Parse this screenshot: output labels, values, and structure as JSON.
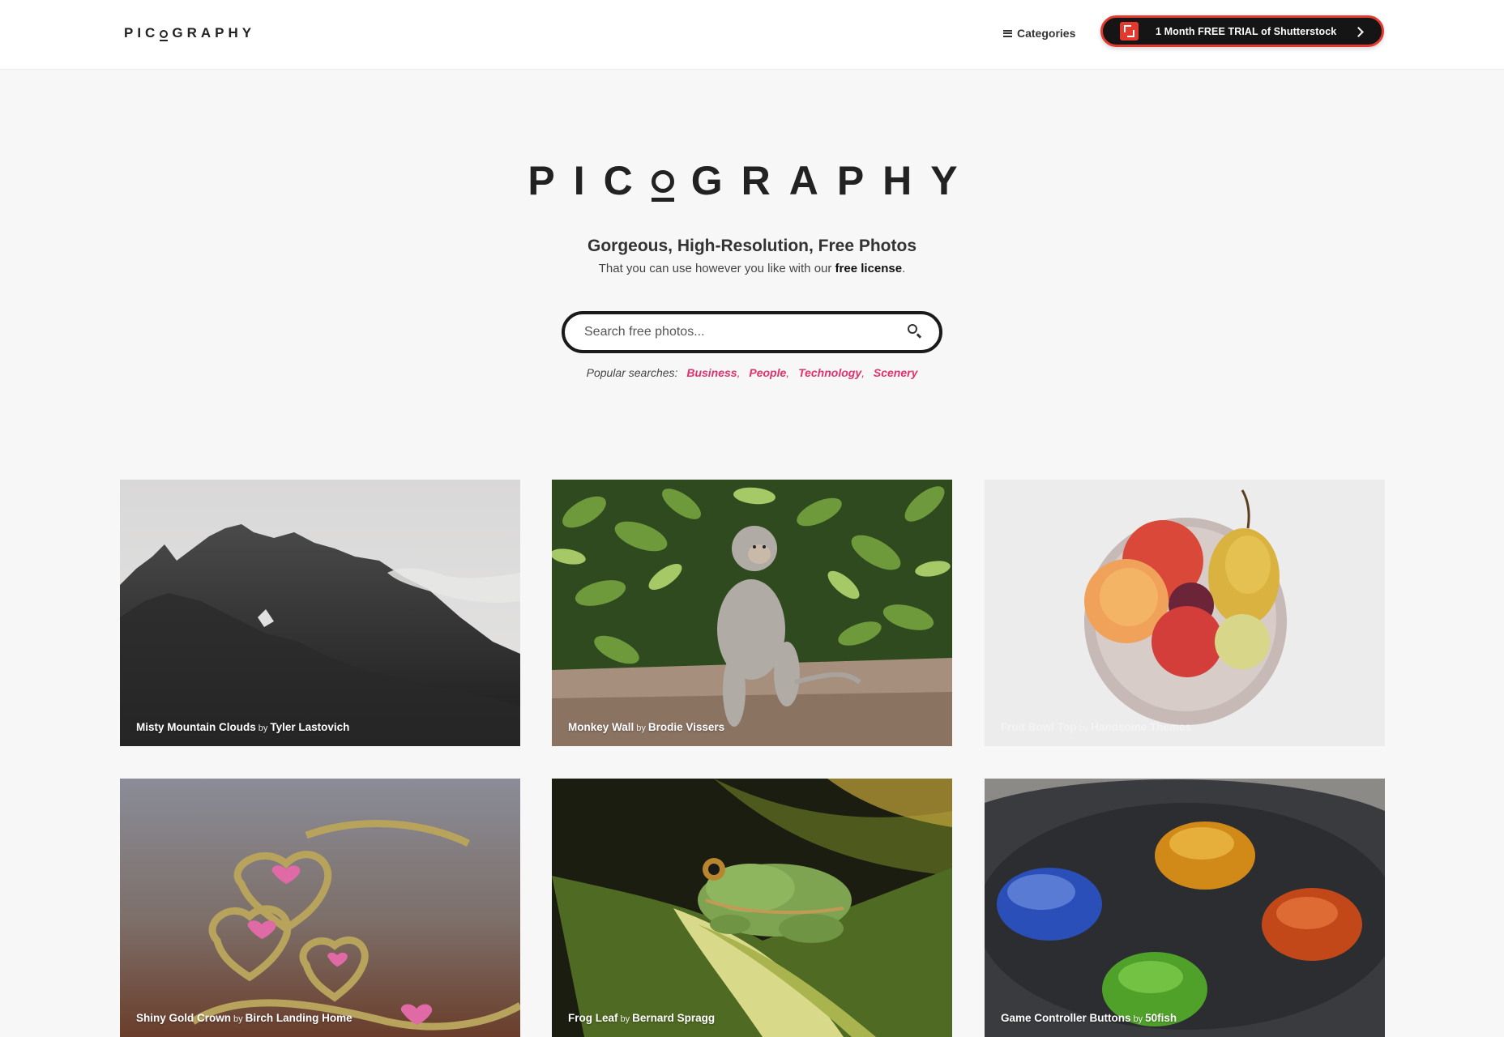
{
  "nav": {
    "brand": {
      "left": "PIC",
      "right": "GRAPHY"
    },
    "categories_label": "Categories",
    "promo_label": "1 Month FREE TRIAL of Shutterstock"
  },
  "hero": {
    "brand": {
      "left": "PIC",
      "right": "GRAPHY"
    },
    "title": "Gorgeous, High-Resolution, Free Photos",
    "subtitle_pre": "That you can use however you like with our",
    "subtitle_link": "free license",
    "subtitle_post": ".",
    "search_placeholder": "Search free photos...",
    "popular_label": "Popular searches:",
    "popular": [
      "Business",
      "People",
      "Technology",
      "Scenery"
    ]
  },
  "photos": [
    {
      "title": "Misty Mountain Clouds",
      "by": "by",
      "author": "Tyler Lastovich"
    },
    {
      "title": "Monkey Wall",
      "by": "by",
      "author": "Brodie Vissers"
    },
    {
      "title": "Fruit Bowl Top",
      "by": "by",
      "author": "Handsome Themes"
    },
    {
      "title": "Shiny Gold Crown",
      "by": "by",
      "author": "Birch Landing Home"
    },
    {
      "title": "Frog Leaf",
      "by": "by",
      "author": "Bernard Spragg"
    },
    {
      "title": "Game Controller Buttons",
      "by": "by",
      "author": "50fish"
    }
  ],
  "colors": {
    "accent_pink": "#e0336b",
    "promo_red": "#e23a2e",
    "promo_bg": "#151515",
    "page_bg": "#f7f7f7"
  },
  "icons": [
    "hamburger-icon",
    "shutterstock-logo-icon",
    "chevron-right-icon",
    "search-icon"
  ]
}
